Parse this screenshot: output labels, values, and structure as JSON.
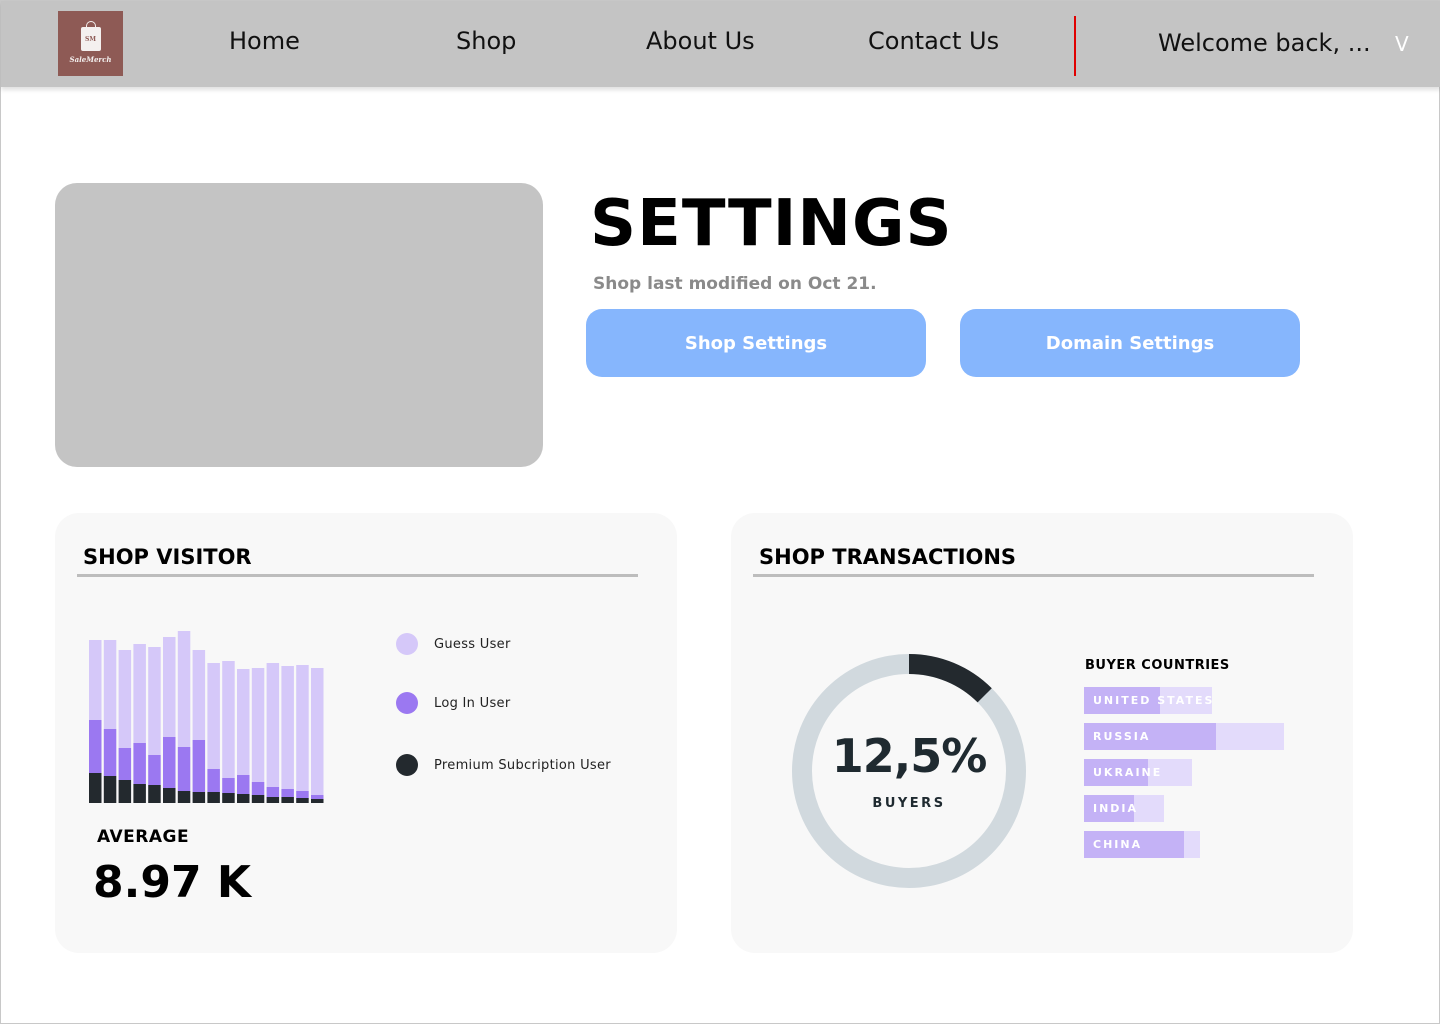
{
  "nav": {
    "logo_text": "SM",
    "logo_name": "SaleMerch",
    "links": [
      {
        "label": "Home"
      },
      {
        "label": "Shop"
      },
      {
        "label": "About Us"
      },
      {
        "label": "Contact Us"
      }
    ],
    "welcome": "Welcome back, ...",
    "chevron": "V",
    "divider_color": "#e00000"
  },
  "hero": {
    "title": "SETTINGS",
    "subtitle": "Shop last modified on Oct 21.",
    "buttons": [
      {
        "label": "Shop Settings"
      },
      {
        "label": "Domain Settings"
      }
    ],
    "button_color": "#86b6fd"
  },
  "visitor": {
    "title": "SHOP VISITOR",
    "legend": [
      {
        "label": "Guess User",
        "color": "#d5c8f9"
      },
      {
        "label": "Log In User",
        "color": "#9b78f1"
      },
      {
        "label": "Premium Subcription User",
        "color": "#23292e"
      }
    ],
    "average_label": "AVERAGE",
    "average_value": "8.97 K",
    "chart_data": {
      "type": "bar",
      "stacked": true,
      "series": [
        {
          "values": [
            30,
            27,
            23,
            19,
            18,
            15,
            12,
            11,
            11,
            10,
            9,
            8,
            6,
            6,
            5,
            4
          ]
        },
        {
          "values": [
            53,
            47,
            32,
            41,
            30,
            51,
            44,
            52,
            23,
            15,
            19,
            13,
            10,
            8,
            7,
            4
          ]
        },
        {
          "values": [
            80,
            89,
            98,
            99,
            108,
            100,
            119,
            90,
            106,
            117,
            106,
            114,
            124,
            123,
            126,
            127
          ]
        }
      ]
    }
  },
  "transactions": {
    "title": "SHOP TRANSACTIONS",
    "donut_value": "12,5%",
    "donut_fraction": 0.125,
    "donut_label": "BUYERS",
    "countries_title": "BUYER COUNTRIES",
    "countries": [
      {
        "name": "UNITED STATES",
        "primary": 0.38,
        "secondary": 0.64
      },
      {
        "name": "RUSSIA",
        "primary": 0.66,
        "secondary": 1.0
      },
      {
        "name": "UKRAINE",
        "primary": 0.32,
        "secondary": 0.54
      },
      {
        "name": "INDIA",
        "primary": 0.25,
        "secondary": 0.4
      },
      {
        "name": "CHINA",
        "primary": 0.5,
        "secondary": 0.58
      }
    ]
  }
}
